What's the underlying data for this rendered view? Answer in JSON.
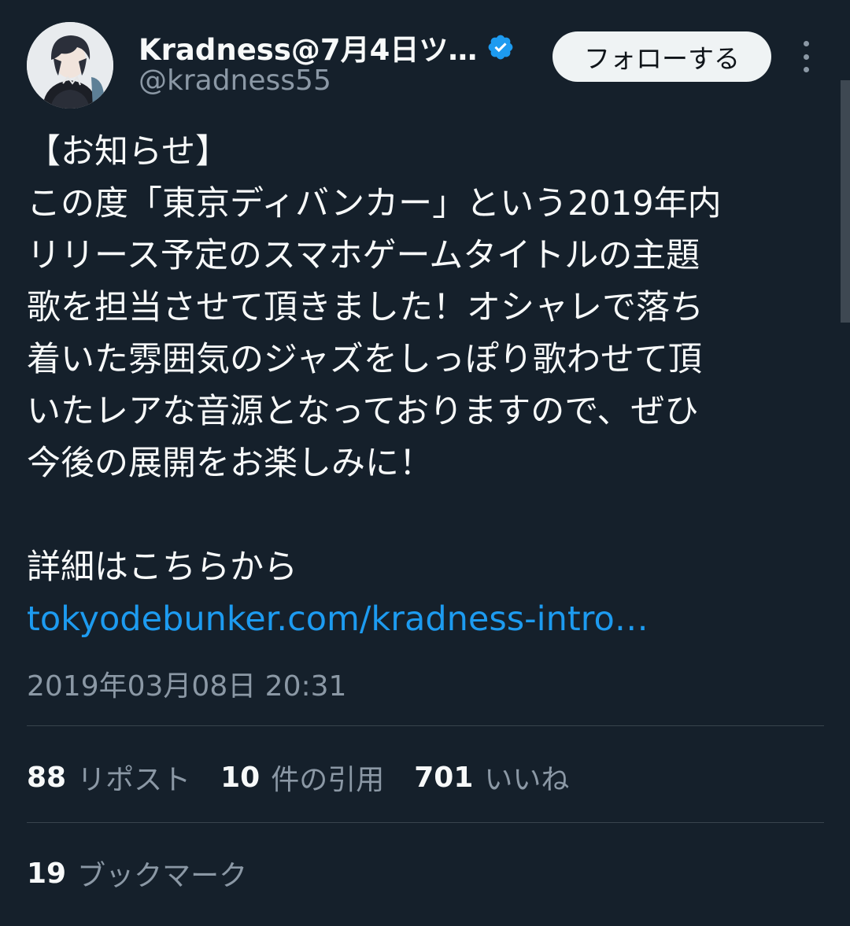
{
  "author": {
    "display_name": "Kradness@7月4日ツ…",
    "handle": "@kradness55",
    "verified": true,
    "avatar_icon": "user-avatar"
  },
  "actions": {
    "follow_label": "フォローする",
    "more_icon": "more-options-icon"
  },
  "tweet": {
    "lines": [
      "【お知らせ】",
      "この度「東京ディバンカー」という2019年内",
      "リリース予定のスマホゲームタイトルの主題",
      "歌を担当させて頂きました！オシャレで落ち",
      "着いた雰囲気のジャズをしっぽり歌わせて頂",
      "いたレアな音源となっておりますので、ぜひ",
      "今後の展開をお楽しみに！",
      "",
      "詳細はこちらから"
    ],
    "link": "tokyodebunker.com/kradness-intro…",
    "timestamp": "2019年03月08日 20:31"
  },
  "stats": {
    "reposts": {
      "count": "88",
      "label": "リポスト"
    },
    "quotes": {
      "count": "10",
      "label": "件の引用"
    },
    "likes": {
      "count": "701",
      "label": "いいね"
    },
    "bookmarks": {
      "count": "19",
      "label": "ブックマーク"
    }
  },
  "colors": {
    "background": "#15202b",
    "text": "#f7f9f9",
    "muted": "#8b98a5",
    "link": "#1d9bf0",
    "verified_badge": "#1d9bf0",
    "divider": "#38444d"
  }
}
